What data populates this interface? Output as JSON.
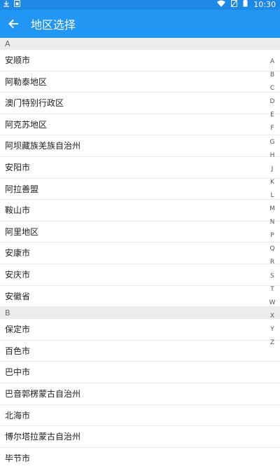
{
  "status_bar": {
    "time": "10:30",
    "icons": [
      "download-icon",
      "sim-icon",
      "wifi-icon",
      "no-sim-icon",
      "battery-icon"
    ]
  },
  "app_bar": {
    "title": "地区选择",
    "back_icon": "arrow-back-icon",
    "colors": {
      "status": "#1E88E5",
      "bar": "#2196F3"
    }
  },
  "sections": [
    {
      "letter": "A",
      "items": [
        "安顺市",
        "阿勒泰地区",
        "澳门特别行政区",
        "阿克苏地区",
        "阿坝藏族羌族自治州",
        "安阳市",
        "阿拉善盟",
        "鞍山市",
        "阿里地区",
        "安康市",
        "安庆市",
        "安徽省"
      ]
    },
    {
      "letter": "B",
      "items": [
        "保定市",
        "百色市",
        "巴中市",
        "巴音郭楞蒙古自治州",
        "北海市",
        "博尔塔拉蒙古自治州",
        "毕节市"
      ]
    }
  ],
  "index_letters": [
    "A",
    "B",
    "C",
    "D",
    "E",
    "F",
    "G",
    "H",
    "J",
    "K",
    "L",
    "M",
    "N",
    "P",
    "Q",
    "R",
    "S",
    "T",
    "W",
    "X",
    "Y",
    "Z"
  ]
}
